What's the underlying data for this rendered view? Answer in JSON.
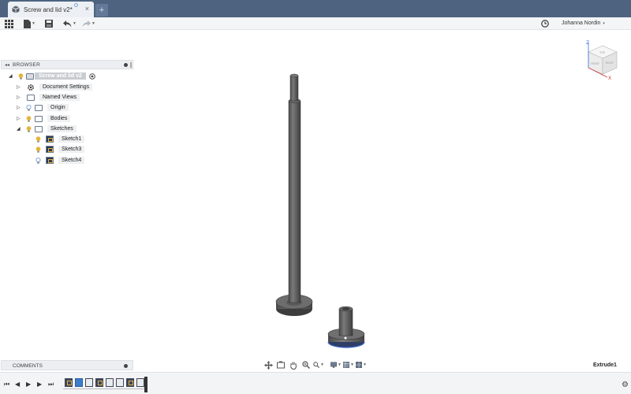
{
  "document": {
    "tab_title": "Screw and lid v2*",
    "tab_close": "×",
    "new_tab": "+"
  },
  "toolbar": {
    "user_name": "Johanna Nordin",
    "user_caret": "▾"
  },
  "browser": {
    "title": "BROWSER",
    "collapse_glyph": "◂◂",
    "root": {
      "label": "Screw and lid v2"
    },
    "items": [
      {
        "label": "Document Settings",
        "icon": "gear-icon"
      },
      {
        "label": "Named Views",
        "icon": "folder-icon"
      },
      {
        "label": "Origin",
        "icon": "folder-icon"
      },
      {
        "label": "Bodies",
        "icon": "folder-icon"
      },
      {
        "label": "Sketches",
        "icon": "folder-icon"
      }
    ],
    "sketches": [
      {
        "label": "Sketch1"
      },
      {
        "label": "Sketch3"
      },
      {
        "label": "Sketch4"
      }
    ]
  },
  "comments": {
    "title": "COMMENTS"
  },
  "status": {
    "active_feature": "Extrude1"
  },
  "viewcube": {
    "top_face": "TOP",
    "front_face": "FRONT",
    "right_face": "RIGHT",
    "z_axis": "Z",
    "x_axis": "X"
  },
  "colors": {
    "titlebar": "#4d6380",
    "accent": "#3d7cc9",
    "body_metal": "#5b5b5b"
  }
}
